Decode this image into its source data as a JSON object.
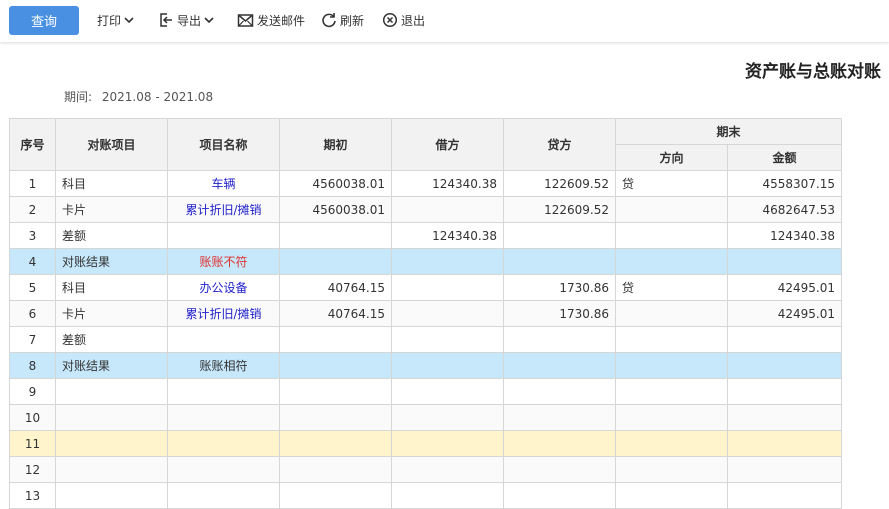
{
  "toolbar": {
    "query_label": "查询",
    "print_label": "打印",
    "export_label": "导出",
    "send_mail_label": "发送邮件",
    "refresh_label": "刷新",
    "exit_label": "退出"
  },
  "report": {
    "title": "资产账与总账对账",
    "period_label": "期间:",
    "period_value": "2021.08 - 2021.08"
  },
  "table": {
    "headers": {
      "seq": "序号",
      "item": "对账项目",
      "name": "项目名称",
      "opening": "期初",
      "debit": "借方",
      "credit": "贷方",
      "ending": "期末",
      "direction": "方向",
      "amount": "金额"
    },
    "rows": [
      {
        "seq": "1",
        "item": "科目",
        "name": "车辆",
        "opening": "4560038.01",
        "debit": "124340.38",
        "credit": "122609.52",
        "direction": "贷",
        "amount": "4558307.15"
      },
      {
        "seq": "2",
        "item": "卡片",
        "name": "累计折旧/摊销",
        "opening": "4560038.01",
        "debit": "",
        "credit": "122609.52",
        "direction": "",
        "amount": "4682647.53"
      },
      {
        "seq": "3",
        "item": "差额",
        "name": "",
        "opening": "",
        "debit": "124340.38",
        "credit": "",
        "direction": "",
        "amount": "124340.38"
      },
      {
        "seq": "4",
        "item": "对账结果",
        "name": "账账不符",
        "opening": "",
        "debit": "",
        "credit": "",
        "direction": "",
        "amount": ""
      },
      {
        "seq": "5",
        "item": "科目",
        "name": "办公设备",
        "opening": "40764.15",
        "debit": "",
        "credit": "1730.86",
        "direction": "贷",
        "amount": "42495.01"
      },
      {
        "seq": "6",
        "item": "卡片",
        "name": "累计折旧/摊销",
        "opening": "40764.15",
        "debit": "",
        "credit": "1730.86",
        "direction": "",
        "amount": "42495.01"
      },
      {
        "seq": "7",
        "item": "差额",
        "name": "",
        "opening": "",
        "debit": "",
        "credit": "",
        "direction": "",
        "amount": ""
      },
      {
        "seq": "8",
        "item": "对账结果",
        "name": "账账相符",
        "opening": "",
        "debit": "",
        "credit": "",
        "direction": "",
        "amount": ""
      },
      {
        "seq": "9",
        "item": "",
        "name": "",
        "opening": "",
        "debit": "",
        "credit": "",
        "direction": "",
        "amount": ""
      },
      {
        "seq": "10",
        "item": "",
        "name": "",
        "opening": "",
        "debit": "",
        "credit": "",
        "direction": "",
        "amount": ""
      },
      {
        "seq": "11",
        "item": "",
        "name": "",
        "opening": "",
        "debit": "",
        "credit": "",
        "direction": "",
        "amount": ""
      },
      {
        "seq": "12",
        "item": "",
        "name": "",
        "opening": "",
        "debit": "",
        "credit": "",
        "direction": "",
        "amount": ""
      },
      {
        "seq": "13",
        "item": "",
        "name": "",
        "opening": "",
        "debit": "",
        "credit": "",
        "direction": "",
        "amount": ""
      }
    ]
  },
  "colors": {
    "primary_button": "#4a90e2",
    "result_row": "#c6e8fa",
    "selected_row": "#fff4cc",
    "link_text": "#2222cc",
    "mismatch_text": "#e03030"
  }
}
